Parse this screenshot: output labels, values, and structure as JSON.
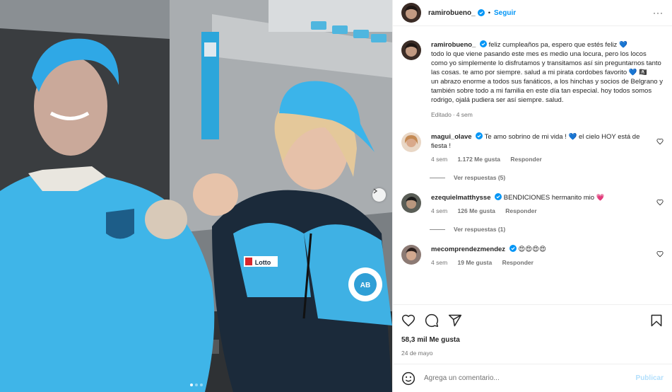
{
  "post": {
    "username": "ramirobueno_",
    "follow_label": "Seguir",
    "separator": "•",
    "more_label": "···"
  },
  "caption": {
    "username": "ramirobueno_",
    "text": "feliz cumpleaños pa, espero que estés feliz 💙\ntodo lo que viene pasando este mes es medio una locura, pero los locos como yo simplemente lo disfrutamos y transitamos así sin preguntarnos tanto las cosas. te amo por siempre. salud a mi pirata cordobes favorito 💙 🏴‍☠️\nun abrazo enorme a todos sus fanáticos, a los hinchas y socios de Belgrano y también sobre todo a mi familia en este día tan especial. hoy todos somos rodrigo, ojalá pudiera ser así siempre. salud.",
    "edited": "Editado",
    "time": "4 sem"
  },
  "comments": [
    {
      "username": "magui_olave",
      "text": "Te amo sobrino de mi vida ! 💙 el cielo HOY está de fiesta !",
      "time": "4 sem",
      "likes": "1.172 Me gusta",
      "reply": "Responder",
      "view_replies": "Ver respuestas (5)"
    },
    {
      "username": "ezequielmatthysse",
      "text": "BENDICIONES hermanito mio 💗",
      "time": "4 sem",
      "likes": "126 Me gusta",
      "reply": "Responder",
      "view_replies": "Ver respuestas (1)"
    },
    {
      "username": "mecomprendezmendez",
      "text": "😍😍😍😍",
      "time": "4 sem",
      "likes": "19 Me gusta",
      "reply": "Responder"
    }
  ],
  "stats": {
    "likes": "58,3 mil Me gusta",
    "date": "24 de mayo"
  },
  "add_comment": {
    "placeholder": "Agrega un comentario...",
    "publish": "Publicar"
  },
  "photo": {
    "badge_brand": "Lotto",
    "badge_club": "CLUB ATLETICO BELGRANO CORDOBA",
    "badge_club_initials": "AB"
  },
  "colors": {
    "accent": "#0095f6",
    "verified": "#0095f6",
    "publish_disabled": "#b2dffc",
    "heart_red": "#ff3040"
  }
}
